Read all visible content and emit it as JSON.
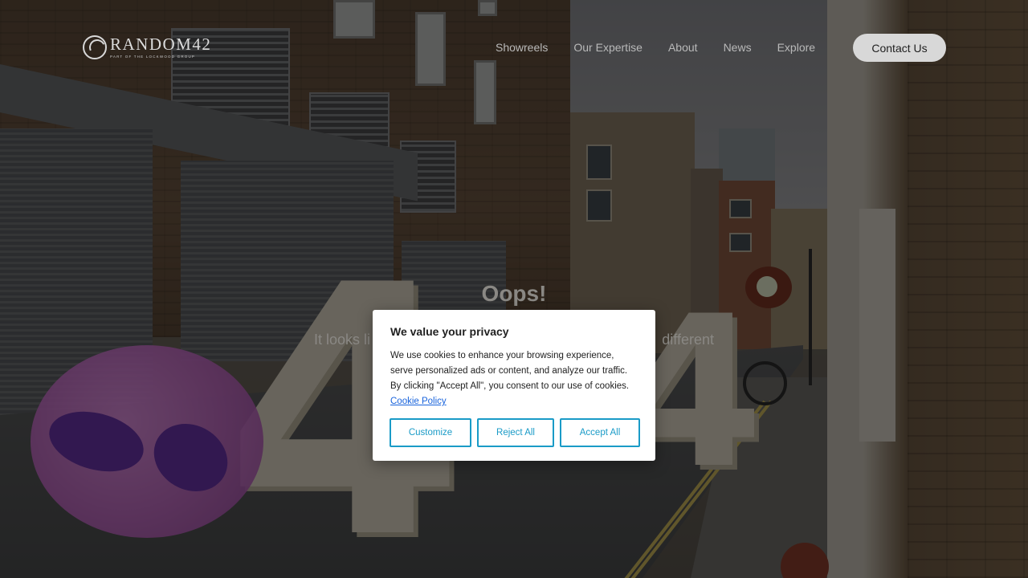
{
  "brand": {
    "name": "RANDOM42",
    "tagline": "PART OF THE LOCKWOOD GROUP"
  },
  "nav": {
    "items": [
      "Showreels",
      "Our Expertise",
      "About",
      "News",
      "Explore"
    ],
    "contact_label": "Contact Us"
  },
  "error": {
    "title": "Oops!",
    "message_left": "It looks li",
    "message_right": "different"
  },
  "cookie": {
    "title": "We value your privacy",
    "body": "We use cookies to enhance your browsing experience, serve personalized ads or content, and analyze our traffic. By clicking \"Accept All\", you consent to our use of cookies.",
    "policy_link": "Cookie Policy",
    "customize_label": "Customize",
    "reject_label": "Reject All",
    "accept_label": "Accept All",
    "accent_color": "#1a9bc7"
  },
  "background": {
    "big_numerals": [
      "4",
      "4"
    ]
  }
}
